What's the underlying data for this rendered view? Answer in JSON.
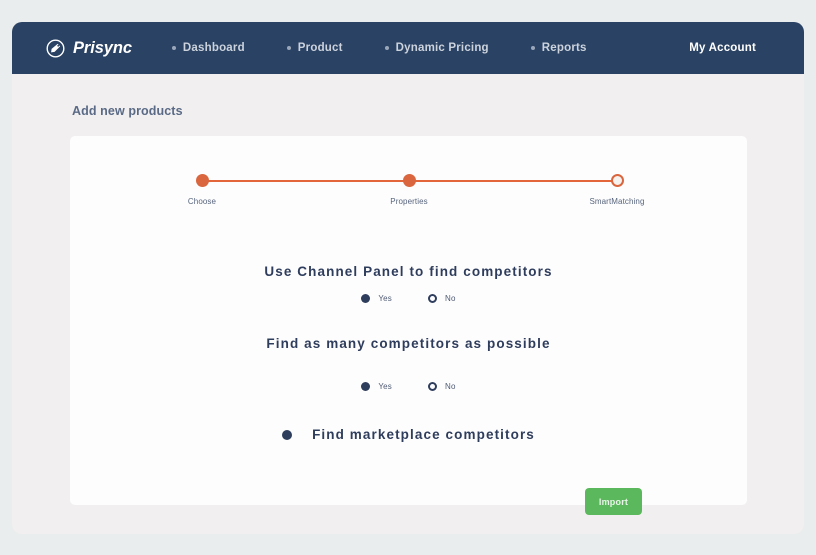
{
  "navbar": {
    "brand": {
      "name": "Prisync",
      "logo_icon": "prisync-tag-circle-icon"
    },
    "items": [
      {
        "label": "Dashboard"
      },
      {
        "label": "Product"
      },
      {
        "label": "Dynamic Pricing"
      },
      {
        "label": "Reports"
      }
    ],
    "account_label": "My Account",
    "background_color": "#2a4263"
  },
  "page": {
    "title": "Add new products",
    "background_color": "#f1efef"
  },
  "stepper": {
    "accent_color": "#d9663e",
    "steps": [
      {
        "label": "Choose",
        "state": "done"
      },
      {
        "label": "Properties",
        "state": "done"
      },
      {
        "label": "SmartMatching",
        "state": "pending"
      }
    ]
  },
  "questions": [
    {
      "text": "Use Channel Panel to find competitors",
      "options": [
        {
          "label": "Yes",
          "selected": true
        },
        {
          "label": "No",
          "selected": false
        }
      ]
    },
    {
      "text": "Find as many competitors as possible",
      "options": [
        {
          "label": "Yes",
          "selected": true
        },
        {
          "label": "No",
          "selected": false
        }
      ]
    }
  ],
  "marketplace_option": {
    "label": "Find marketplace competitors",
    "selected": true
  },
  "actions": {
    "import_label": "Import",
    "import_color": "#5cb85c"
  }
}
